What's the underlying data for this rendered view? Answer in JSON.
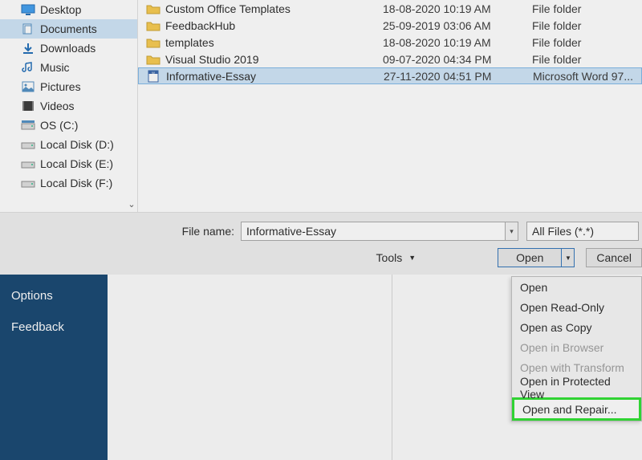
{
  "sidebar": [
    {
      "label": "Desktop",
      "icon": "desktop",
      "sel": false
    },
    {
      "label": "Documents",
      "icon": "documents",
      "sel": true
    },
    {
      "label": "Downloads",
      "icon": "downloads",
      "sel": false
    },
    {
      "label": "Music",
      "icon": "music",
      "sel": false
    },
    {
      "label": "Pictures",
      "icon": "pictures",
      "sel": false
    },
    {
      "label": "Videos",
      "icon": "videos",
      "sel": false
    },
    {
      "label": "OS (C:)",
      "icon": "drive-os",
      "sel": false
    },
    {
      "label": "Local Disk (D:)",
      "icon": "drive",
      "sel": false
    },
    {
      "label": "Local Disk (E:)",
      "icon": "drive",
      "sel": false
    },
    {
      "label": "Local Disk (F:)",
      "icon": "drive",
      "sel": false
    }
  ],
  "files": [
    {
      "name": "Custom Office Templates",
      "date": "18-08-2020 10:19 AM",
      "type": "File folder",
      "kind": "folder",
      "sel": false
    },
    {
      "name": "FeedbackHub",
      "date": "25-09-2019 03:06 AM",
      "type": "File folder",
      "kind": "folder",
      "sel": false
    },
    {
      "name": "templates",
      "date": "18-08-2020 10:19 AM",
      "type": "File folder",
      "kind": "folder",
      "sel": false
    },
    {
      "name": "Visual Studio 2019",
      "date": "09-07-2020 04:34 PM",
      "type": "File folder",
      "kind": "folder",
      "sel": false
    },
    {
      "name": "Informative-Essay",
      "date": "27-11-2020 04:51 PM",
      "type": "Microsoft Word 97...",
      "kind": "doc",
      "sel": true
    }
  ],
  "filename_label": "File name:",
  "filename_value": "Informative-Essay",
  "filter": "All Files (*.*)",
  "tools_label": "Tools",
  "open_label": "Open",
  "cancel_label": "Cancel",
  "back": {
    "options": "Options",
    "feedback": "Feedback"
  },
  "dropdown": [
    {
      "label": "Open",
      "disabled": false,
      "hl": false
    },
    {
      "label": "Open Read-Only",
      "disabled": false,
      "hl": false
    },
    {
      "label": "Open as Copy",
      "disabled": false,
      "hl": false
    },
    {
      "label": "Open in Browser",
      "disabled": true,
      "hl": false
    },
    {
      "label": "Open with Transform",
      "disabled": true,
      "hl": false
    },
    {
      "label": "Open in Protected View",
      "disabled": false,
      "hl": false
    },
    {
      "label": "Open and Repair...",
      "disabled": false,
      "hl": true
    }
  ]
}
